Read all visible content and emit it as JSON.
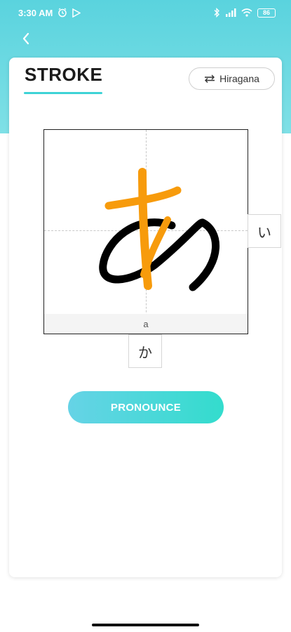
{
  "status_bar": {
    "time": "3:30 AM",
    "battery": "86",
    "icons": [
      "alarm-icon",
      "play-store-icon",
      "bluetooth-icon",
      "signal-icon",
      "wifi-icon",
      "battery-icon"
    ]
  },
  "header": {
    "title": "STROKE",
    "script_toggle_label": "Hiragana",
    "accent_color": "#3ed3d6"
  },
  "stroke_board": {
    "character": "あ",
    "romaji": "a",
    "stroke_colors": {
      "completed": "#000000",
      "highlight": "#f79b0c"
    }
  },
  "neighbors": {
    "next_char": "い",
    "below_char": "か"
  },
  "actions": {
    "pronounce_label": "PRONOUNCE"
  }
}
